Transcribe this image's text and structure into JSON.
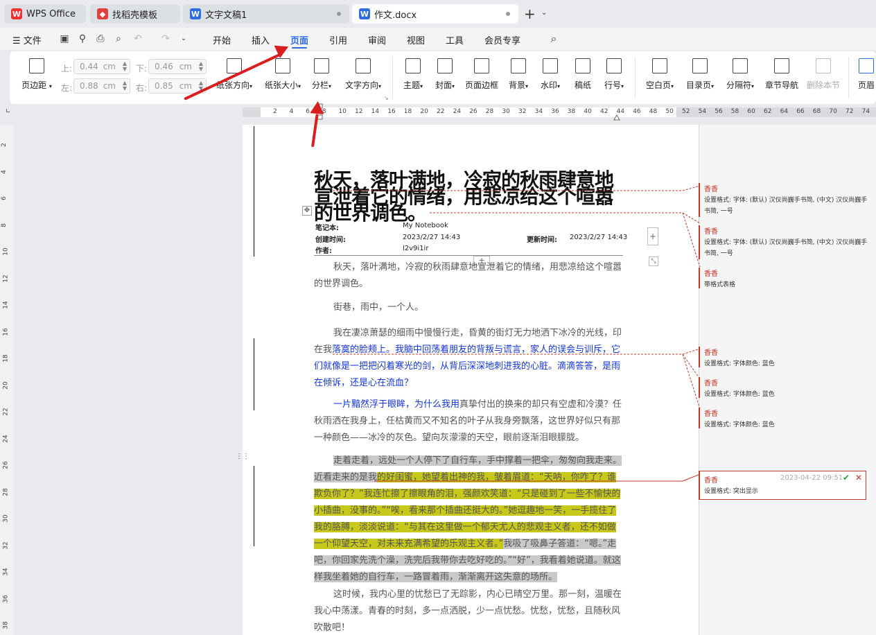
{
  "tabs": [
    {
      "label": "WPS Office"
    },
    {
      "label": "找稻壳模板"
    },
    {
      "label": "文字文稿1"
    },
    {
      "label": "作文.docx"
    }
  ],
  "new_tab": "+",
  "menu": {
    "file": "文件",
    "items": [
      "开始",
      "插入",
      "页面",
      "引用",
      "审阅",
      "视图",
      "工具",
      "会员专享"
    ],
    "active": "页面"
  },
  "ribbon": {
    "margins": "页边距",
    "top_label": "上:",
    "top_value": "0.44",
    "bottom_label": "下:",
    "bottom_value": "0.46",
    "left_label": "左:",
    "left_value": "0.88",
    "right_label": "右:",
    "right_value": "0.85",
    "unit": "cm",
    "orientation": "纸张方向",
    "size": "纸张大小",
    "columns": "分栏",
    "text_direction": "文字方向",
    "theme": "主题",
    "cover": "封面",
    "page_border": "页面边框",
    "background": "背景",
    "watermark": "水印",
    "manuscript": "稿纸",
    "line_number": "行号",
    "blank_page": "空白页",
    "toc_page": "目录页",
    "separator": "分隔符",
    "section_nav": "章节导航",
    "delete_section": "删除本节",
    "header": "页眉"
  },
  "hruler_ticks": [
    "2",
    "4",
    "6",
    "8",
    "10",
    "12",
    "14",
    "16",
    "18",
    "20",
    "22",
    "24",
    "26",
    "28",
    "30",
    "32",
    "34",
    "36",
    "38",
    "40",
    "42",
    "44",
    "46",
    "48",
    "50",
    "52",
    "54",
    "56",
    "58",
    "60",
    "62",
    "64",
    "66",
    "68",
    "70",
    "72",
    "74"
  ],
  "vruler_ticks": [
    "2",
    "4",
    "6",
    "8",
    "10",
    "12",
    "14",
    "16",
    "18",
    "20",
    "22",
    "24",
    "26",
    "28",
    "30",
    "32",
    "34",
    "36",
    "38"
  ],
  "doc": {
    "title": "秋天，落叶满地，冷寂的秋雨肆意地宣泄着它的情绪，用悲凉给这个喧嚣的世界调色。",
    "notebook_label": "笔记本:",
    "notebook_value": "My Notebook",
    "created_label": "创建时间:",
    "created_value": "2023/2/27 14:43",
    "updated_label": "更新时间:",
    "updated_value": "2023/2/27 14:43",
    "author_label": "作者:",
    "author_value": "l2v9i1ir",
    "p1": "秋天，落叶满地，冷寂的秋雨肆意地宣泄着它的情绪，用悲凉给这个喧嚣的世界调色。",
    "p2": "街巷，雨中，一个人。",
    "p3a": "我在凄凉萧瑟的细雨中慢慢行走，昏黄的街灯无力地洒下冰冷的光线，印在我",
    "p3b": "落寞的脸颊上。我脑中回荡着朋友的背叛与谎言，家人的误会与训斥，它们就像是一把把闪着寒光的剑，从背后深深地刺进我的心脏。滴滴答答，是雨在倾诉，还是心在流血？",
    "p4a": "一片黯然浮于眼眸，为什么我用",
    "p4b": "真挚付出的换来的却只有空虚和冷漠？任秋雨洒在我身上，任枯黄而又不知名的叶子从我身旁飘落，这世界好似只有那一种颜色——冰冷的灰色。望向灰濛濛的天空，眼前逐渐泪眼朦胧。",
    "p5a": "走着走着，远处一个人停下了自行车，手中撑着一把伞，匆匆向我走来。近看走来的是我",
    "p5b": "的好闺蜜，她望着出神的我，皱着眉道：“天呐，你咋了？谁欺负你了？”我连忙擦了擦眼角的泪，强颜欢笑道：“只是碰到了一些不愉快的小插曲，没事的。”“唉，看来那个插曲还挺大的。”她逗趣地一笑，一手揽住了我的胳膊，淡淡说道：“与其在这里做一个郁天尤人的悲观主义者，还不如做一个仰望天空，对未来充满希望的乐观主义者。”",
    "p5c": "我吸了吸鼻子答道：“嗯。”走吧，你回家先洗个澡，洗完后我带你去吃好吃的。”“好”，我看着她说道。就这样我坐着她的自行车，一路冒着雨，渐渐离开这失意的场所。",
    "p6": "这时候，我内心里的忧愁已了无踪影，内心已晴空万里。那一刻，温暖在我心中荡漾。青春的时刻，多一点洒脱，少一点忧愁。忧愁，忧愁，且随秋风吹散吧！"
  },
  "comments": [
    {
      "author": "香香",
      "text": "设置格式: 字体: (默认) 汉仪尚巍手书简, (中文) 汉仪尚巍手书简, 一号"
    },
    {
      "author": "香香",
      "text": "设置格式: 字体: (默认) 汉仪尚巍手书简, (中文) 汉仪尚巍手书简, 一号"
    },
    {
      "author": "香香",
      "text": "带格式表格"
    },
    {
      "author": "香香",
      "text": "设置格式: 字体颜色: 蓝色"
    },
    {
      "author": "香香",
      "text": "设置格式: 字体颜色: 蓝色"
    },
    {
      "author": "香香",
      "text": "设置格式: 字体颜色: 蓝色"
    },
    {
      "author": "香香",
      "text": "设置格式: 突出显示",
      "time": "2023-04-22 09:51"
    }
  ],
  "colors": {
    "accent": "#2d6cdf",
    "annotation_red": "#c0392b",
    "arrow": "#d81e1e",
    "highlight_yellow": "#c8c81a",
    "revision_blue": "#1436d6"
  }
}
